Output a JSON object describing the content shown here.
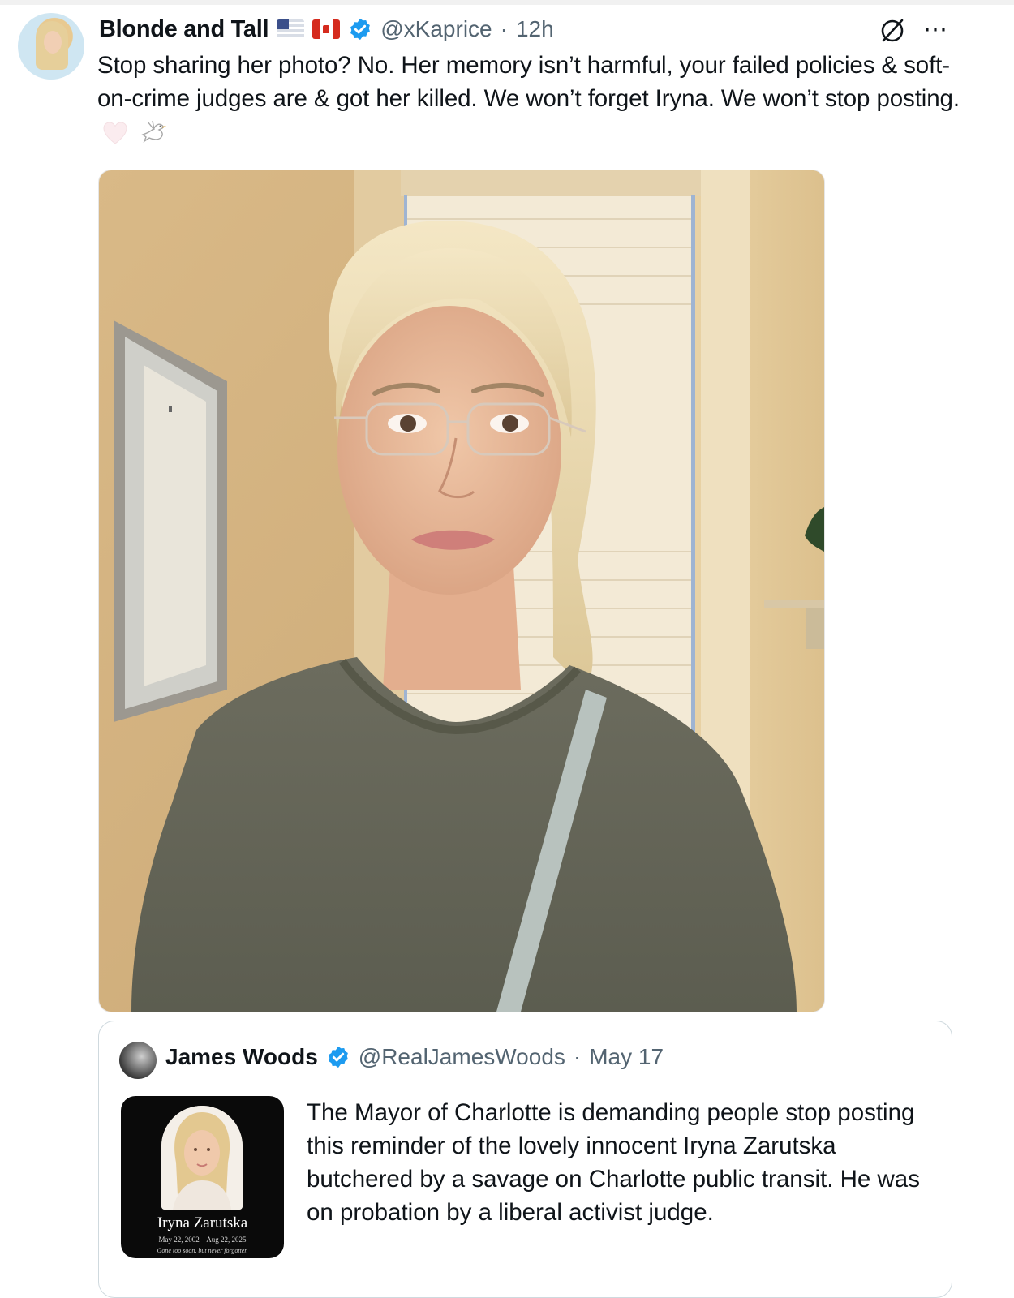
{
  "tweet": {
    "author_name": "Blonde and Tall",
    "handle": "@xKaprice",
    "separator": "·",
    "time": "12h",
    "text": "Stop sharing her photo? No. Her memory isn’t harmful, your  failed policies & soft-on-crime judges are & got her killed. We won’t forget Iryna. We won’t stop posting.",
    "emojis": [
      "white-heart-icon",
      "dove-icon"
    ],
    "header_icons": [
      "flag-us-icon",
      "flag-canada-icon",
      "verified-badge-icon",
      "grok-icon",
      "more-icon"
    ]
  },
  "quoted_tweet": {
    "author_name": "James Woods",
    "handle": "@RealJamesWoods",
    "separator": "·",
    "time": "May 17",
    "text": "The Mayor of Charlotte is demanding people stop posting this reminder of the lovely innocent Iryna Zarutska butchered by a savage on Charlotte public transit. He was on probation by a liberal activist judge.",
    "card": {
      "name": "Iryna Zarutska",
      "dates": "May 22, 2002 – Aug 22, 2025",
      "motto": "Gone too soon, but never forgotten"
    }
  },
  "colors": {
    "text": "#0f1419",
    "secondary_text": "#536471",
    "verified_blue": "#1d9bf0",
    "border": "#cfd9de"
  }
}
